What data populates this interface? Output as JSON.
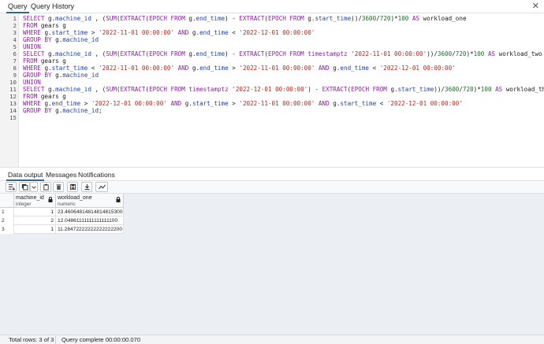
{
  "top_tabs": [
    "Query",
    "Query History"
  ],
  "close_glyph": "✕",
  "editor_lines": [
    [
      [
        "kw",
        "SELECT "
      ],
      [
        "",
        "g."
      ],
      [
        "id",
        "machine_id"
      ],
      [
        "",
        " , ("
      ],
      [
        "kw",
        "SUM"
      ],
      [
        "",
        "("
      ],
      [
        "kw",
        "EXTRACT"
      ],
      [
        "",
        "("
      ],
      [
        "kw",
        "EPOCH FROM "
      ],
      [
        "",
        "g."
      ],
      [
        "id",
        "end_time"
      ],
      [
        "",
        ") - "
      ],
      [
        "kw",
        "EXTRACT"
      ],
      [
        "",
        "("
      ],
      [
        "kw",
        "EPOCH FROM "
      ],
      [
        "",
        "g."
      ],
      [
        "id",
        "start_time"
      ],
      [
        "",
        "))/"
      ],
      [
        "num",
        "3600"
      ],
      [
        "",
        "/"
      ],
      [
        "num",
        "720"
      ],
      [
        "",
        ")*"
      ],
      [
        "num",
        "100"
      ],
      [
        "",
        " "
      ],
      [
        "kw",
        "AS "
      ],
      [
        "",
        "workload_one"
      ]
    ],
    [
      [
        "kw",
        "FROM "
      ],
      [
        "",
        "gears g"
      ]
    ],
    [
      [
        "kw",
        "WHERE "
      ],
      [
        "",
        "g."
      ],
      [
        "id",
        "start_time"
      ],
      [
        "",
        " > "
      ],
      [
        "str",
        "'2022-11-01 00:00:00'"
      ],
      [
        "",
        " "
      ],
      [
        "kw",
        "AND "
      ],
      [
        "",
        "g."
      ],
      [
        "id",
        "end_time"
      ],
      [
        "",
        " < "
      ],
      [
        "str",
        "'2022-12-01 00:00:00'"
      ]
    ],
    [
      [
        "kw",
        "GROUP BY "
      ],
      [
        "",
        "g."
      ],
      [
        "id",
        "machine_id"
      ]
    ],
    [
      [
        "kw",
        "UNION"
      ]
    ],
    [
      [
        "kw",
        "SELECT "
      ],
      [
        "",
        "g."
      ],
      [
        "id",
        "machine_id"
      ],
      [
        "",
        " , ("
      ],
      [
        "kw",
        "SUM"
      ],
      [
        "",
        "("
      ],
      [
        "kw",
        "EXTRACT"
      ],
      [
        "",
        "("
      ],
      [
        "kw",
        "EPOCH FROM "
      ],
      [
        "",
        "g."
      ],
      [
        "id",
        "end_time"
      ],
      [
        "",
        ") - "
      ],
      [
        "kw",
        "EXTRACT"
      ],
      [
        "",
        "("
      ],
      [
        "kw",
        "EPOCH FROM "
      ],
      [
        "kw",
        "timestamptz "
      ],
      [
        "str",
        "'2022-11-01 00:00:00'"
      ],
      [
        "",
        "))/"
      ],
      [
        "num",
        "3600"
      ],
      [
        "",
        "/"
      ],
      [
        "num",
        "720"
      ],
      [
        "",
        ")*"
      ],
      [
        "num",
        "100"
      ],
      [
        "",
        " "
      ],
      [
        "kw",
        "AS "
      ],
      [
        "",
        "workload_two"
      ]
    ],
    [
      [
        "kw",
        "FROM "
      ],
      [
        "",
        "gears g"
      ]
    ],
    [
      [
        "kw",
        "WHERE "
      ],
      [
        "",
        "g."
      ],
      [
        "id",
        "start_time"
      ],
      [
        "",
        " < "
      ],
      [
        "str",
        "'2022-11-01 00:00:00'"
      ],
      [
        "",
        " "
      ],
      [
        "kw",
        "AND "
      ],
      [
        "",
        "g."
      ],
      [
        "id",
        "end_time"
      ],
      [
        "",
        " > "
      ],
      [
        "str",
        "'2022-11-01 00:00:00'"
      ],
      [
        "",
        " "
      ],
      [
        "kw",
        "AND "
      ],
      [
        "",
        "g."
      ],
      [
        "id",
        "end_time"
      ],
      [
        "",
        " < "
      ],
      [
        "str",
        "'2022-12-01 00:00:00'"
      ]
    ],
    [
      [
        "kw",
        "GROUP BY "
      ],
      [
        "",
        "g."
      ],
      [
        "id",
        "machine_id"
      ]
    ],
    [
      [
        "kw",
        "UNION"
      ]
    ],
    [
      [
        "kw",
        "SELECT "
      ],
      [
        "",
        "g."
      ],
      [
        "id",
        "machine_id"
      ],
      [
        "",
        " , ("
      ],
      [
        "kw",
        "SUM"
      ],
      [
        "",
        "("
      ],
      [
        "kw",
        "EXTRACT"
      ],
      [
        "",
        "("
      ],
      [
        "kw",
        "EPOCH FROM "
      ],
      [
        "kw",
        "timestamptz "
      ],
      [
        "str",
        "'2022-12-01 00:00:00'"
      ],
      [
        "",
        ") - "
      ],
      [
        "kw",
        "EXTRACT"
      ],
      [
        "",
        "("
      ],
      [
        "kw",
        "EPOCH FROM "
      ],
      [
        "",
        "g."
      ],
      [
        "id",
        "start_time"
      ],
      [
        "",
        "))/"
      ],
      [
        "num",
        "3600"
      ],
      [
        "",
        "/"
      ],
      [
        "num",
        "720"
      ],
      [
        "",
        ")*"
      ],
      [
        "num",
        "100"
      ],
      [
        "",
        " "
      ],
      [
        "kw",
        "AS "
      ],
      [
        "",
        "workload_three"
      ]
    ],
    [
      [
        "kw",
        "FROM "
      ],
      [
        "",
        "gears g"
      ]
    ],
    [
      [
        "kw",
        "WHERE "
      ],
      [
        "",
        "g."
      ],
      [
        "id",
        "end_time"
      ],
      [
        "",
        " > "
      ],
      [
        "str",
        "'2022-12-01 00:00:00'"
      ],
      [
        "",
        " "
      ],
      [
        "kw",
        "AND "
      ],
      [
        "",
        "g."
      ],
      [
        "id",
        "start_time"
      ],
      [
        "",
        " > "
      ],
      [
        "str",
        "'2022-11-01 00:00:00'"
      ],
      [
        "",
        " "
      ],
      [
        "kw",
        "AND "
      ],
      [
        "",
        "g."
      ],
      [
        "id",
        "start_time"
      ],
      [
        "",
        " < "
      ],
      [
        "str",
        "'2022-12-01 00:00:00'"
      ]
    ],
    [
      [
        "kw",
        "GROUP BY "
      ],
      [
        "",
        "g."
      ],
      [
        "id",
        "machine_id"
      ],
      [
        "",
        ";"
      ]
    ],
    [],
    []
  ],
  "line_numbers": [
    "1",
    "2",
    "3",
    "4",
    "5",
    "6",
    "7",
    "8",
    "9",
    "10",
    "11",
    "12",
    "13",
    "14",
    "15"
  ],
  "result_tabs": [
    "Data output",
    "Messages",
    "Notifications"
  ],
  "toolbar_icons": [
    "add-row-icon",
    "copy-icon",
    "dropdown-caret-icon",
    "paste-icon",
    "delete-icon",
    "save-data-icon",
    "download-icon",
    "graph-icon"
  ],
  "columns": [
    {
      "name": "machine_id",
      "type": "integer"
    },
    {
      "name": "workload_one",
      "type": "numeric"
    }
  ],
  "rows": [
    {
      "n": "1",
      "machine_id": "1",
      "workload_one": "23.46064814814814815300"
    },
    {
      "n": "2",
      "machine_id": "2",
      "workload_one": "12.04861111111111111100"
    },
    {
      "n": "3",
      "machine_id": "1",
      "workload_one": "11.28472222222222222200"
    }
  ],
  "status": {
    "total_rows": "Total rows: 3 of 3",
    "query_time": "Query complete 00:00:00.070"
  },
  "colors": {
    "accent": "#326690",
    "keyword": "#8b1fa0",
    "identifier": "#1f3fa8",
    "string": "#b5281d",
    "number": "#1c6b2a"
  }
}
